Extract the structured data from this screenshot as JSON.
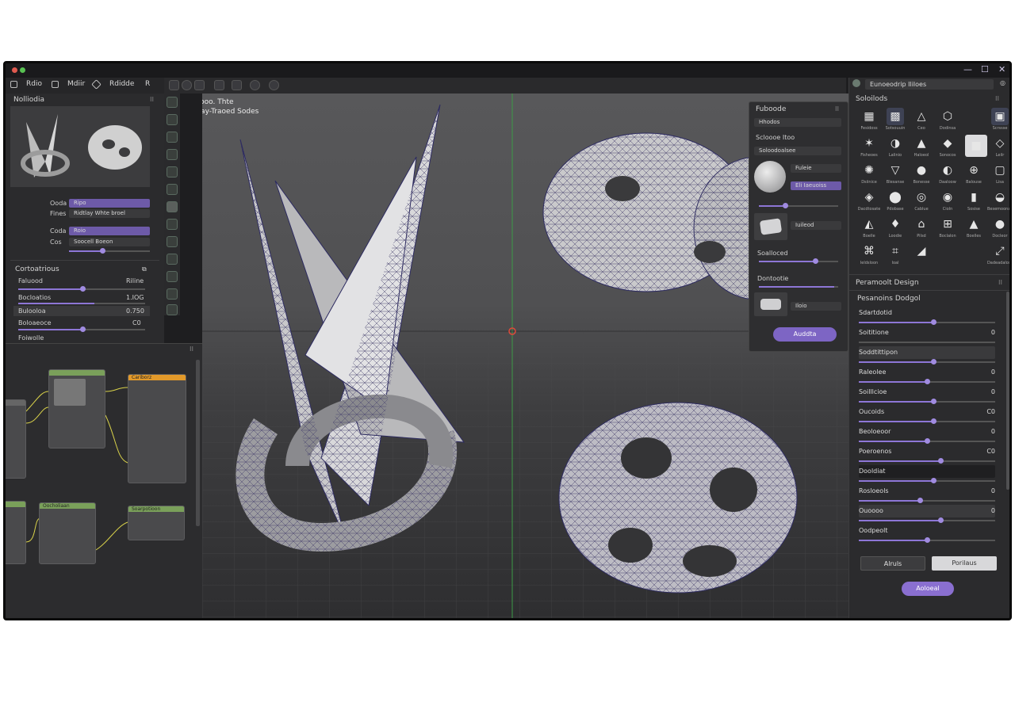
{
  "menu": {
    "items": [
      "Rdio",
      "Mdiir",
      "Rdidde",
      "R"
    ]
  },
  "viewport": {
    "line1": "Iiooo. Thte",
    "line2": "Ray-Traoed Sodes"
  },
  "left_panel": {
    "title": "Nolliodia",
    "fields": [
      {
        "label": "Ooda",
        "value": "Ripo"
      },
      {
        "label": "Fines",
        "value": "Ridtlay Whte broel"
      },
      {
        "label": "Coda",
        "value": "Roio"
      },
      {
        "label": "Cos",
        "value": "Soocell Boeon"
      }
    ],
    "section_title": "Cortoatrious",
    "rows": [
      {
        "label": "Faluood",
        "value": "Riline"
      },
      {
        "label": "Bocloatios",
        "value": "1.IOG"
      },
      {
        "label": "Bulooloa",
        "value": "0.750"
      },
      {
        "label": "Boloaeoce",
        "value": "C0"
      },
      {
        "label": "Foiwolle",
        "value": ""
      }
    ]
  },
  "float_panel": {
    "title": "Fuboode",
    "field1": "Hhodos",
    "section": "Scloooe Itoo",
    "dropdown": "Soloodoalsee",
    "item1_select": "Fuleie",
    "item1_btn": "Eli Iaeuoiss",
    "item2_select": "Iuileod",
    "row1": "Soalloced",
    "row2": "Dontootie",
    "item3_select": "Iloio",
    "action": "Auddta"
  },
  "right_panel": {
    "header": "Eunoeodrip Ililoes",
    "section": "Soloilods",
    "icons": [
      {
        "name": "grid-icon",
        "glyph": "▦",
        "label": "Fesidoss"
      },
      {
        "name": "grid2-icon",
        "glyph": "▩",
        "label": "Sotsouuin"
      },
      {
        "name": "pyramid-icon",
        "glyph": "△",
        "label": "Ceo"
      },
      {
        "name": "cube-outline-icon",
        "glyph": "⬡",
        "label": "Dodinsa"
      },
      {
        "name": "blank1-icon",
        "glyph": "",
        "label": ""
      },
      {
        "name": "cube-icon",
        "glyph": "▣",
        "label": "Scrssse"
      },
      {
        "name": "knot-icon",
        "glyph": "✶",
        "label": "Fisheoes"
      },
      {
        "name": "circle-icon",
        "glyph": "◑",
        "label": "Lalinio"
      },
      {
        "name": "cone-icon",
        "glyph": "▲",
        "label": "Haloeol"
      },
      {
        "name": "box-icon",
        "glyph": "◆",
        "label": "Sonocos"
      },
      {
        "name": "white-cube-icon",
        "glyph": "■",
        "label": ""
      },
      {
        "name": "diamond-icon",
        "glyph": "◇",
        "label": "Leilr"
      },
      {
        "name": "star-icon",
        "glyph": "✺",
        "label": "Dsiinice"
      },
      {
        "name": "triangle-icon",
        "glyph": "▽",
        "label": "Blesanse"
      },
      {
        "name": "drop-icon",
        "glyph": "●",
        "label": "Bonesse"
      },
      {
        "name": "sphere-icon",
        "glyph": "◐",
        "label": "Daaloow"
      },
      {
        "name": "crosshair-icon",
        "glyph": "⊕",
        "label": "Balouse"
      },
      {
        "name": "frame-icon",
        "glyph": "▢",
        "label": "Lisa"
      },
      {
        "name": "path-icon",
        "glyph": "◈",
        "label": "Dacdtosate"
      },
      {
        "name": "ball-icon",
        "glyph": "⬤",
        "label": "Pdobase"
      },
      {
        "name": "ring-icon",
        "glyph": "◎",
        "label": "Cablue"
      },
      {
        "name": "torus-icon",
        "glyph": "◉",
        "label": "Cioln"
      },
      {
        "name": "cylinder-icon",
        "glyph": "▮",
        "label": "Sosise"
      },
      {
        "name": "bowl-icon",
        "glyph": "◒",
        "label": "Besemoonas"
      },
      {
        "name": "gem-icon",
        "glyph": "◭",
        "label": "Boelle"
      },
      {
        "name": "flame-icon",
        "glyph": "♦",
        "label": "Loodie"
      },
      {
        "name": "tent-icon",
        "glyph": "⌂",
        "label": "Pilsd"
      },
      {
        "name": "lattice-icon",
        "glyph": "⊞",
        "label": "Boclalon"
      },
      {
        "name": "spike-icon",
        "glyph": "▲",
        "label": "Boelles"
      },
      {
        "name": "orb-icon",
        "glyph": "●",
        "label": "Docleor"
      },
      {
        "name": "twist-icon",
        "glyph": "⌘",
        "label": "Ieldsloon"
      },
      {
        "name": "mesh-icon",
        "glyph": "⌗",
        "label": "Ioal"
      },
      {
        "name": "tool-icon",
        "glyph": "◢",
        "label": ""
      },
      {
        "name": "blank2-icon",
        "glyph": "",
        "label": ""
      },
      {
        "name": "blank3-icon",
        "glyph": "",
        "label": ""
      },
      {
        "name": "stretch-icon",
        "glyph": "⤢",
        "label": "Dadeadaloss"
      }
    ],
    "design_title": "Peramoolt Design",
    "design_sub": "Pesanoins Dodgol",
    "params": [
      {
        "label": "Sdartdotid",
        "value": "",
        "fill": 0.55
      },
      {
        "label": "Soititione",
        "value": "0",
        "fill": 0.0
      },
      {
        "label": "Soddtittipon",
        "value": "",
        "fill": 0.55,
        "boxed": true
      },
      {
        "label": "Raleolee",
        "value": "0",
        "fill": 0.5
      },
      {
        "label": "Soilllcioe",
        "value": "0",
        "fill": 0.55
      },
      {
        "label": "Oucoids",
        "value": "C0",
        "fill": 0.55
      },
      {
        "label": "Beoloeoor",
        "value": "0",
        "fill": 0.5
      },
      {
        "label": "Poeroenos",
        "value": "C0",
        "fill": 0.6
      },
      {
        "label": "Dooldiat",
        "value": "",
        "fill": 0.55,
        "dropdown": true
      },
      {
        "label": "Rosloeols",
        "value": "0",
        "fill": 0.45
      },
      {
        "label": "Ouoooo",
        "value": "0",
        "fill": 0.6,
        "boxed": true
      },
      {
        "label": "Oodpeolt",
        "value": "",
        "fill": 0.5
      }
    ],
    "btn_left": "Alruls",
    "btn_right": "Porilaus",
    "btn_apply": "Aoloeal"
  },
  "node_nodes": [
    {
      "title": "",
      "color": "#7aa05a"
    },
    {
      "title": "Cariborz",
      "color": "#e39a2a"
    },
    {
      "title": "Oocholiaan",
      "color": "#7aa05a"
    },
    {
      "title": "Soarpotioon",
      "color": "#7aa05a"
    }
  ]
}
